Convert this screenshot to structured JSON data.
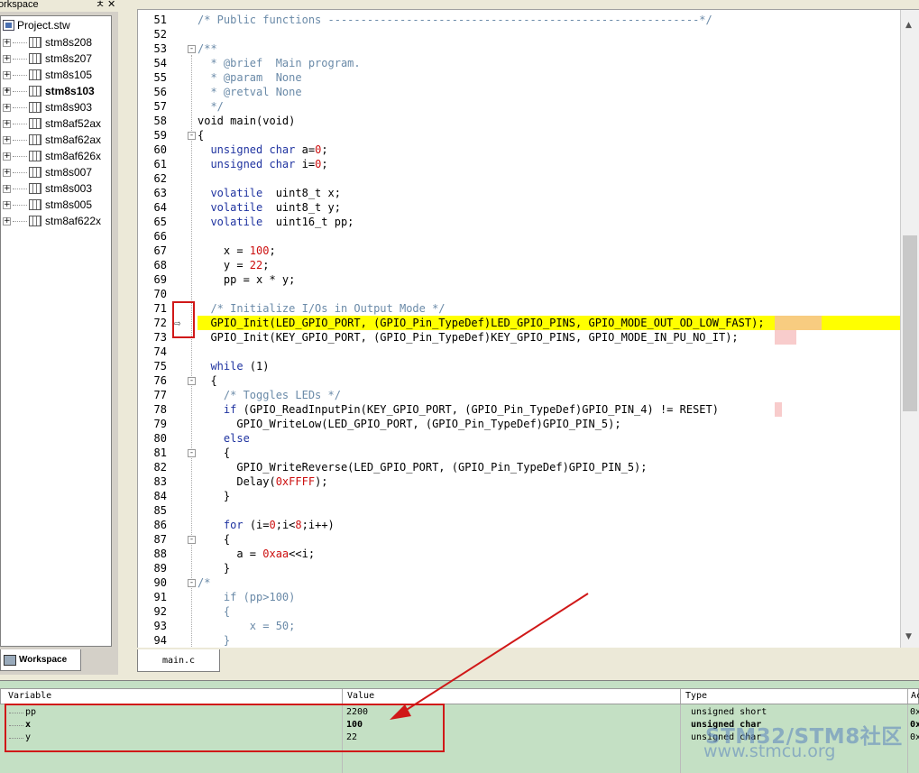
{
  "workspace": {
    "title": "orkspace",
    "pin_btn": "ㅊ",
    "close_btn": "✕",
    "root": "Project.stw",
    "items": [
      {
        "label": "stm8s208",
        "bold": false
      },
      {
        "label": "stm8s207",
        "bold": false
      },
      {
        "label": "stm8s105",
        "bold": false
      },
      {
        "label": "stm8s103",
        "bold": true
      },
      {
        "label": "stm8s903",
        "bold": false
      },
      {
        "label": "stm8af52ax",
        "bold": false
      },
      {
        "label": "stm8af62ax",
        "bold": false
      },
      {
        "label": "stm8af626x",
        "bold": false
      },
      {
        "label": "stm8s007",
        "bold": false
      },
      {
        "label": "stm8s003",
        "bold": false
      },
      {
        "label": "stm8s005",
        "bold": false
      },
      {
        "label": "stm8af622x",
        "bold": false
      }
    ],
    "tab_label": "Workspace"
  },
  "editor": {
    "file_tab": "main.c",
    "current_line": "72",
    "lines": [
      {
        "n": "51",
        "t": "/* Public functions ---------------------------------------------------------*/",
        "c": "cm"
      },
      {
        "n": "52",
        "t": "",
        "c": ""
      },
      {
        "n": "53",
        "t": "/**",
        "c": "cm",
        "fold": "-"
      },
      {
        "n": "54",
        "t": "  * @brief  Main program.",
        "c": "cm"
      },
      {
        "n": "55",
        "t": "  * @param  None",
        "c": "cm"
      },
      {
        "n": "56",
        "t": "  * @retval None",
        "c": "cm"
      },
      {
        "n": "57",
        "t": "  */",
        "c": "cm"
      },
      {
        "n": "58",
        "t": "void main(void)",
        "c": "fn"
      },
      {
        "n": "59",
        "t": "{",
        "c": "fn",
        "fold": "-"
      },
      {
        "n": "60",
        "t": "  unsigned char a=0;",
        "c": "fn"
      },
      {
        "n": "61",
        "t": "  unsigned char i=0;",
        "c": "fn"
      },
      {
        "n": "62",
        "t": "",
        "c": ""
      },
      {
        "n": "63",
        "t": "  volatile  uint8_t x;",
        "c": "fn"
      },
      {
        "n": "64",
        "t": "  volatile  uint8_t y;",
        "c": "fn"
      },
      {
        "n": "65",
        "t": "  volatile  uint16_t pp;",
        "c": "fn"
      },
      {
        "n": "66",
        "t": "",
        "c": ""
      },
      {
        "n": "67",
        "t": "    x = 100;",
        "c": "fn"
      },
      {
        "n": "68",
        "t": "    y = 22;",
        "c": "fn"
      },
      {
        "n": "69",
        "t": "    pp = x * y;",
        "c": "fn"
      },
      {
        "n": "70",
        "t": "",
        "c": ""
      },
      {
        "n": "71",
        "t": "  /* Initialize I/Os in Output Mode */",
        "c": "cm"
      },
      {
        "n": "72",
        "t": "  GPIO_Init(LED_GPIO_PORT, (GPIO_Pin_TypeDef)LED_GPIO_PINS, GPIO_MODE_OUT_OD_LOW_FAST);",
        "c": "fn",
        "hl": true
      },
      {
        "n": "73",
        "t": "  GPIO_Init(KEY_GPIO_PORT, (GPIO_Pin_TypeDef)KEY_GPIO_PINS, GPIO_MODE_IN_PU_NO_IT);",
        "c": "fn"
      },
      {
        "n": "74",
        "t": "",
        "c": ""
      },
      {
        "n": "75",
        "t": "  while (1)",
        "c": "fn"
      },
      {
        "n": "76",
        "t": "  {",
        "c": "fn",
        "fold": "-"
      },
      {
        "n": "77",
        "t": "    /* Toggles LEDs */",
        "c": "cm"
      },
      {
        "n": "78",
        "t": "    if (GPIO_ReadInputPin(KEY_GPIO_PORT, (GPIO_Pin_TypeDef)GPIO_PIN_4) != RESET)",
        "c": "fn"
      },
      {
        "n": "79",
        "t": "      GPIO_WriteLow(LED_GPIO_PORT, (GPIO_Pin_TypeDef)GPIO_PIN_5);",
        "c": "fn"
      },
      {
        "n": "80",
        "t": "    else",
        "c": "fn"
      },
      {
        "n": "81",
        "t": "    {",
        "c": "fn",
        "fold": "-"
      },
      {
        "n": "82",
        "t": "      GPIO_WriteReverse(LED_GPIO_PORT, (GPIO_Pin_TypeDef)GPIO_PIN_5);",
        "c": "fn"
      },
      {
        "n": "83",
        "t": "      Delay(0xFFFF);",
        "c": "fn"
      },
      {
        "n": "84",
        "t": "    }",
        "c": "fn"
      },
      {
        "n": "85",
        "t": "",
        "c": ""
      },
      {
        "n": "86",
        "t": "    for (i=0;i<8;i++)",
        "c": "fn"
      },
      {
        "n": "87",
        "t": "    {",
        "c": "fn",
        "fold": "-"
      },
      {
        "n": "88",
        "t": "      a = 0xaa<<i;",
        "c": "fn"
      },
      {
        "n": "89",
        "t": "    }",
        "c": "fn"
      },
      {
        "n": "90",
        "t": "/*",
        "c": "cm",
        "fold": "-"
      },
      {
        "n": "91",
        "t": "    if (pp>100)",
        "c": "cm"
      },
      {
        "n": "92",
        "t": "    {",
        "c": "cm"
      },
      {
        "n": "93",
        "t": "        x = 50;",
        "c": "cm"
      },
      {
        "n": "94",
        "t": "    }",
        "c": "cm"
      }
    ]
  },
  "watch": {
    "headers": [
      "Variable",
      "Value",
      "Type",
      "Ac"
    ],
    "rows": [
      {
        "name": "pp",
        "value": "2200",
        "type": "unsigned short",
        "addr": "0x",
        "bold": false
      },
      {
        "name": "x",
        "value": "100",
        "type": "unsigned char",
        "addr": "0x",
        "bold": true
      },
      {
        "name": "y",
        "value": "22",
        "type": "unsigned char",
        "addr": "0x",
        "bold": false
      }
    ]
  },
  "watermark": {
    "brand": "STM32/STM8社区",
    "url": "www.stmcu.org"
  },
  "colors": {
    "highlight": "#ffff00",
    "annotation": "#d01818",
    "watch_bg": "#c4e0c4"
  }
}
